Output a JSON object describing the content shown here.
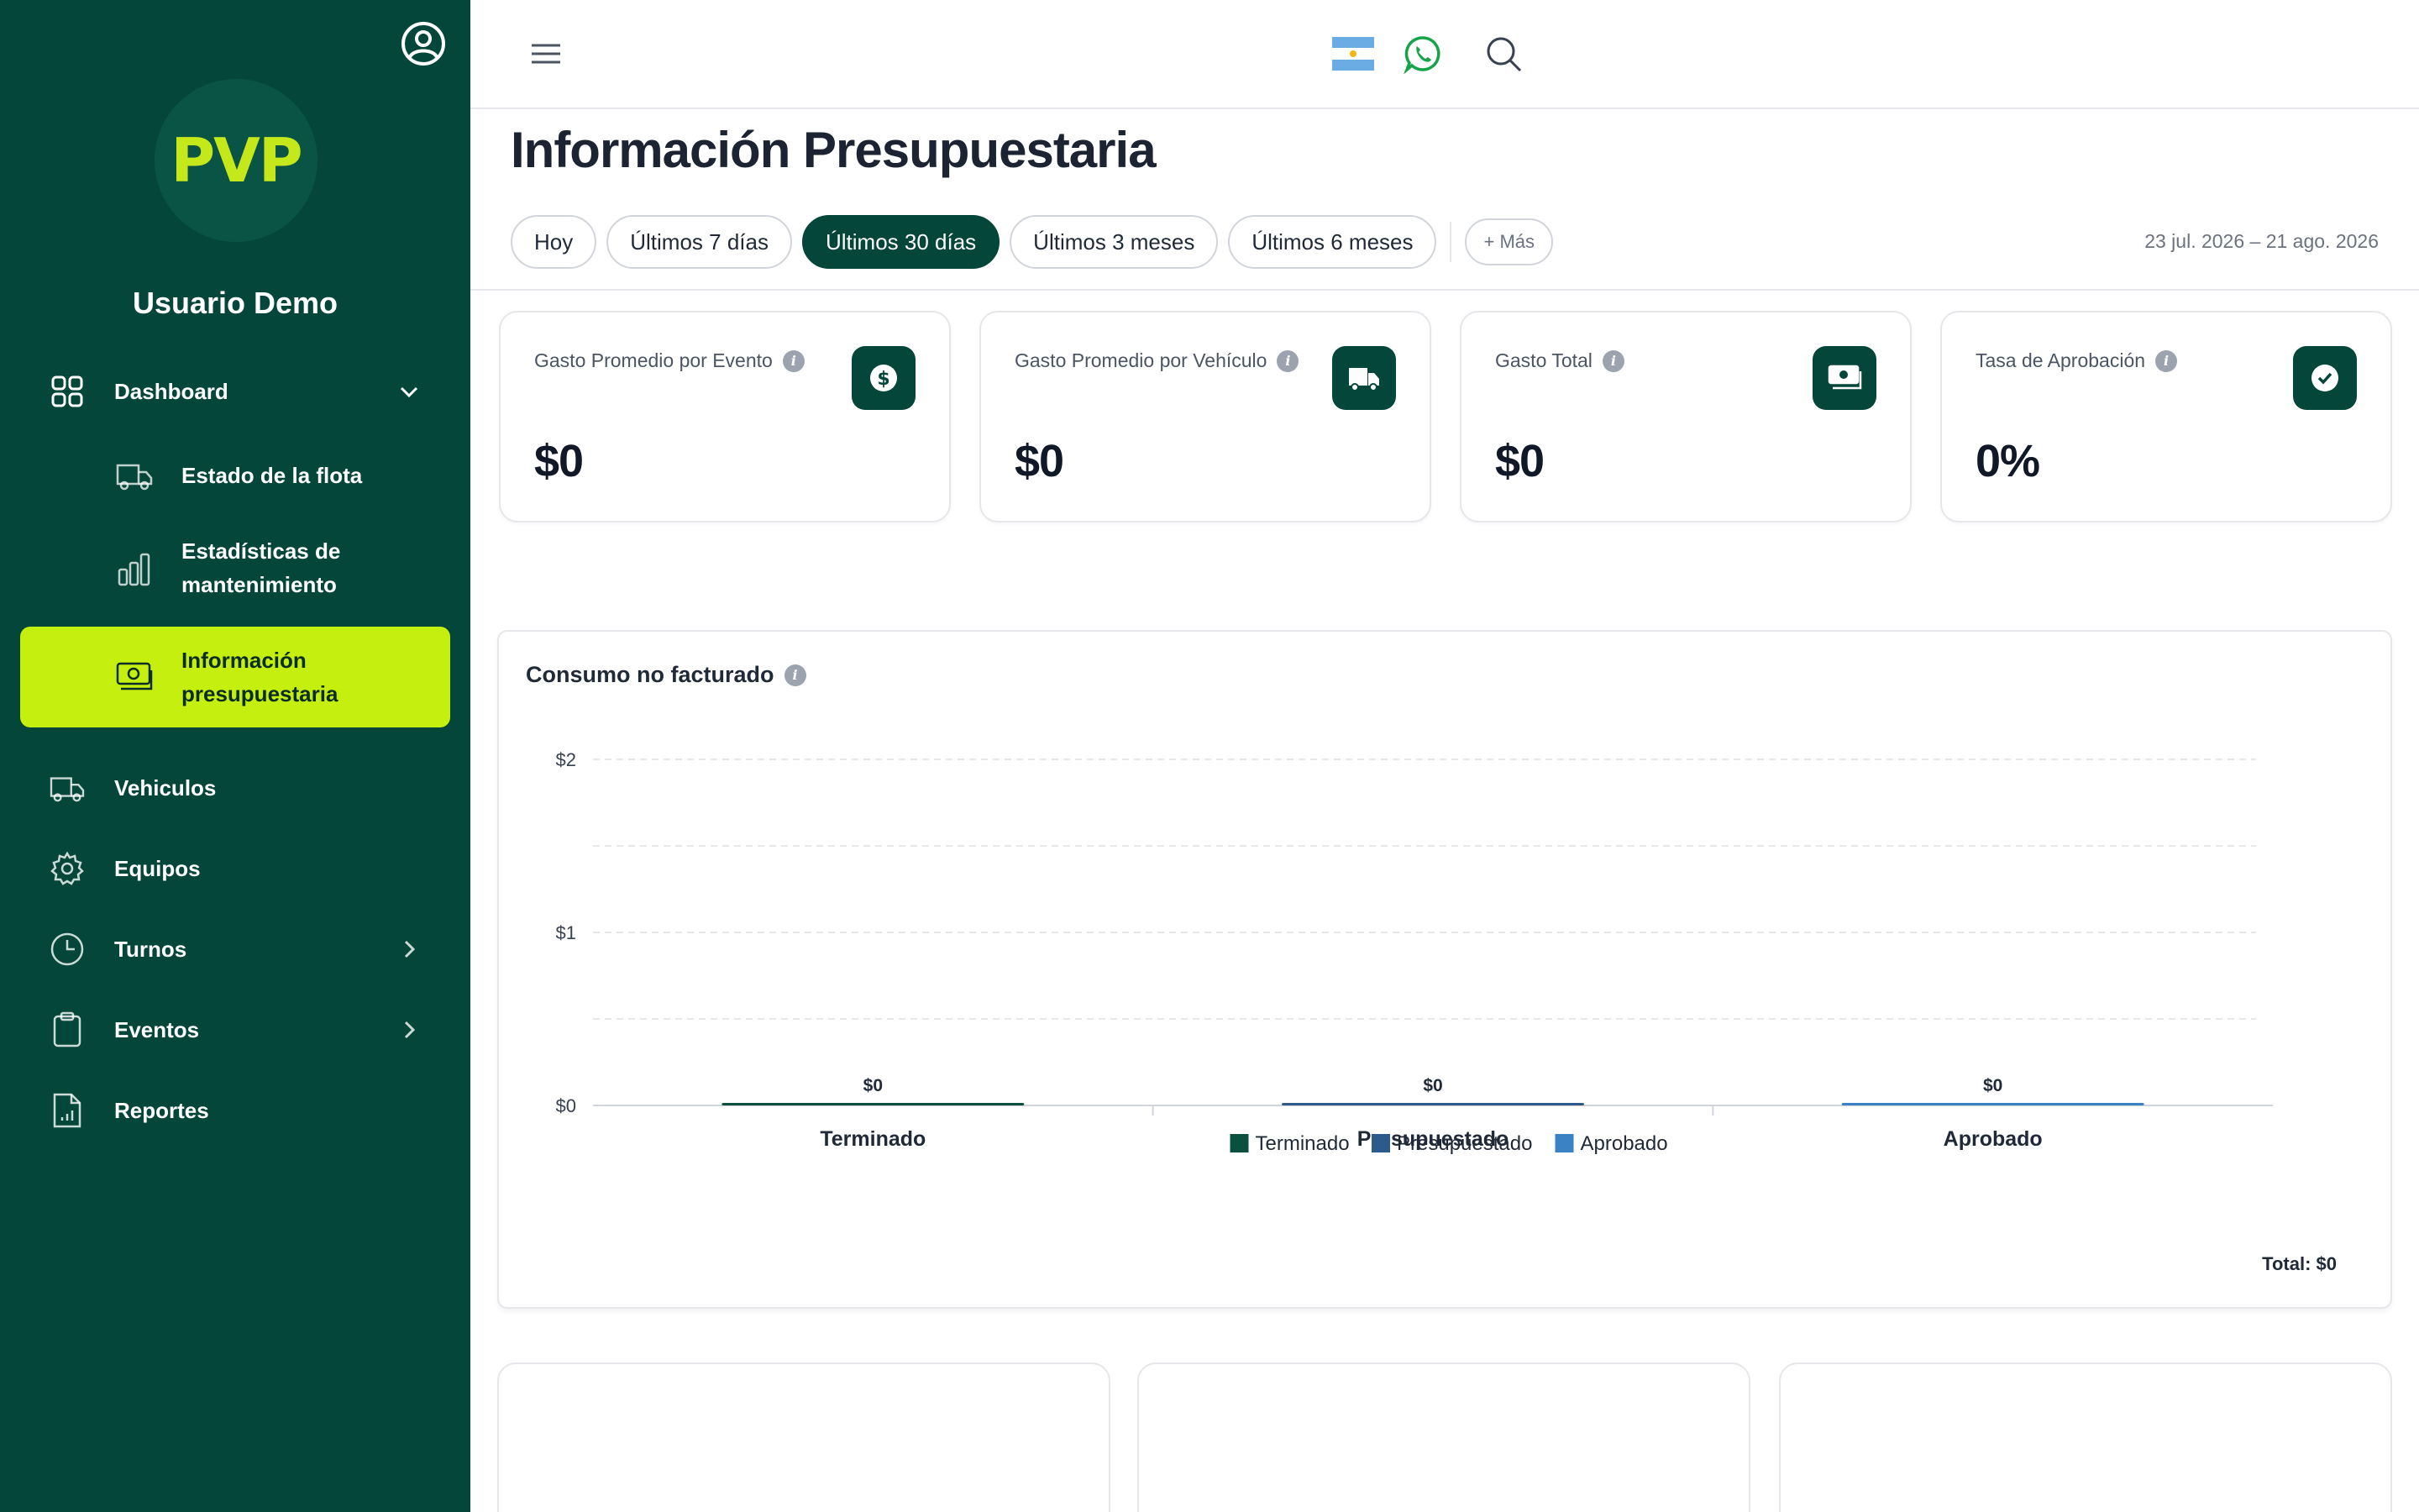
{
  "sidebar": {
    "user_name": "Usuario Demo",
    "logo_text": "PVP",
    "items": [
      {
        "label": "Dashboard",
        "icon": "grid-icon"
      },
      {
        "label": "Vehiculos",
        "icon": "truck-icon"
      },
      {
        "label": "Equipos",
        "icon": "gear-icon"
      },
      {
        "label": "Turnos",
        "icon": "clock-icon"
      },
      {
        "label": "Eventos",
        "icon": "clipboard-icon"
      },
      {
        "label": "Reportes",
        "icon": "report-icon"
      }
    ],
    "sub_items": [
      {
        "label": "Estado de la flota",
        "icon": "truck-icon"
      },
      {
        "label_line1": "Estadísticas de",
        "label_line2": "mantenimiento",
        "icon": "bar-chart-icon"
      },
      {
        "label_line1": "Información",
        "label_line2": "presupuestaria",
        "icon": "money-icon",
        "active": true
      }
    ]
  },
  "page": {
    "title": "Información Presupuestaria",
    "filters": [
      "Hoy",
      "Últimos 7 días",
      "Últimos 30 días",
      "Últimos 3 meses",
      "Últimos 6 meses"
    ],
    "more_filter": "+ Más",
    "active_filter": "Últimos 30 días",
    "date_range": "23 jul. 2026 – 21 ago. 2026"
  },
  "kpis": [
    {
      "label": "Gasto Promedio por Evento",
      "value": "$0",
      "icon": "dollar-icon"
    },
    {
      "label": "Gasto Promedio por Vehículo",
      "value": "$0",
      "icon": "truck-icon"
    },
    {
      "label": "Gasto Total",
      "value": "$0",
      "icon": "cash-icon"
    },
    {
      "label": "Tasa de Aprobación",
      "value": "0%",
      "icon": "check-icon"
    }
  ],
  "chart": {
    "title": "Consumo no facturado",
    "total": "Total: $0"
  },
  "colors": {
    "sidebar": "#04463a",
    "accent": "#c5ef0e",
    "terminado": "#0b4f3f",
    "presupuestado": "#2c5a8a",
    "aprobado": "#3b82c4"
  },
  "chart_data": {
    "type": "bar",
    "categories": [
      "Terminado",
      "Presupuestado",
      "Aprobado"
    ],
    "values": [
      0,
      0,
      0
    ],
    "data_labels": [
      "$0",
      "$0",
      "$0"
    ],
    "colors": [
      "#0b4f3f",
      "#2c5a8a",
      "#3b82c4"
    ],
    "ylim": [
      0,
      2
    ],
    "yticks": [
      0,
      1,
      2
    ],
    "ytick_labels": [
      "$0",
      "$1",
      "$2"
    ],
    "legend": [
      "Terminado",
      "Presupuestado",
      "Aprobado"
    ],
    "legend_position": "bottom",
    "grid": true
  }
}
